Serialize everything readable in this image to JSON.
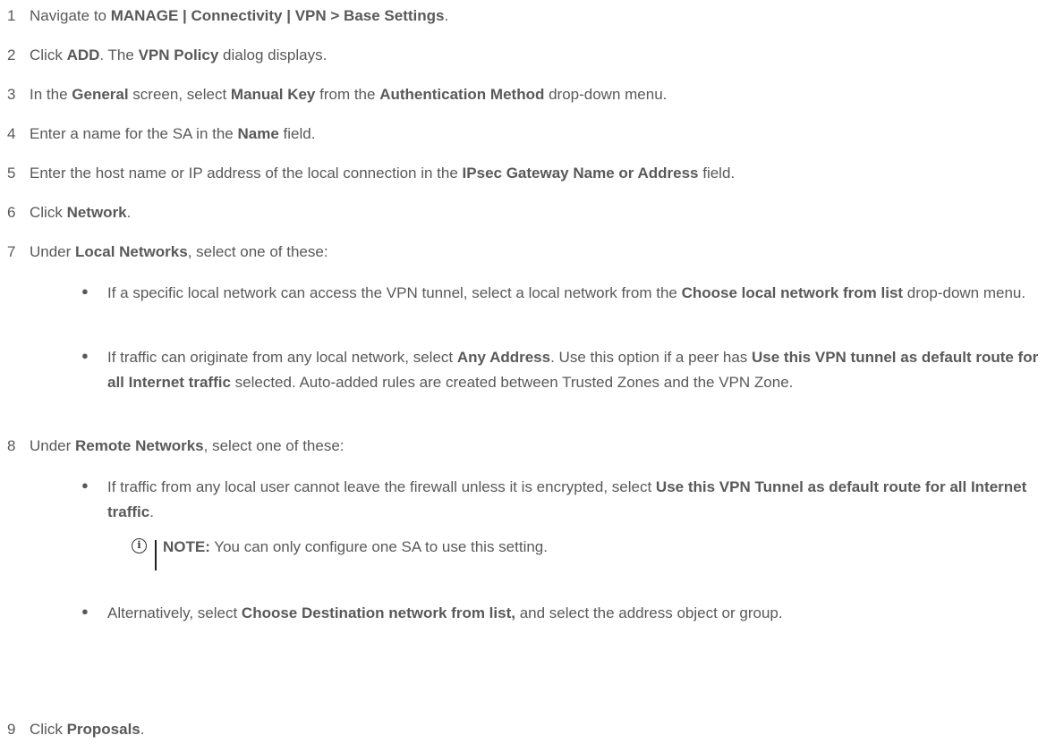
{
  "steps": [
    {
      "num": "1",
      "parts": [
        "Navigate to ",
        "MANAGE | Connectivity | VPN > Base Settings",
        "."
      ]
    },
    {
      "num": "2",
      "parts": [
        "Click ",
        "ADD",
        ". The ",
        "VPN Policy",
        " dialog displays."
      ]
    },
    {
      "num": "3",
      "parts": [
        "In the ",
        "General",
        " screen, select ",
        "Manual Key",
        " from the ",
        "Authentication Method",
        " drop-down menu."
      ]
    },
    {
      "num": "4",
      "parts": [
        "Enter a name for the SA in the ",
        "Name",
        " field."
      ]
    },
    {
      "num": "5",
      "parts": [
        "Enter the host name or IP address of the local connection in the ",
        "IPsec Gateway Name or Address",
        " field."
      ]
    },
    {
      "num": "6",
      "parts": [
        "Click ",
        "Network",
        "."
      ]
    },
    {
      "num": "7",
      "parts": [
        "Under ",
        "Local Networks",
        ", select one of these:"
      ]
    },
    {
      "num": "8",
      "parts": [
        "Under ",
        "Remote Networks",
        ", select one of these:"
      ]
    },
    {
      "num": "9",
      "parts": [
        "Click ",
        "Proposals",
        "."
      ]
    }
  ],
  "bullets_step7": [
    {
      "parts": [
        "If a specific local network can access the VPN tunnel, select a local network from the ",
        "Choose local network from list",
        " drop-down menu."
      ]
    },
    {
      "parts": [
        "If traffic can originate from any local network, select ",
        "Any Address",
        ". Use this option if a peer has ",
        "Use this VPN tunnel as default route for all Internet traffic",
        " selected. Auto-added rules are created between Trusted Zones and the VPN Zone."
      ]
    }
  ],
  "bullets_step8": [
    {
      "parts": [
        "If traffic from any local user cannot leave the firewall unless it is encrypted, select ",
        "Use this VPN Tunnel as default route for all Internet traffic",
        "."
      ]
    },
    {
      "parts": [
        "Alternatively, select ",
        "Choose Destination network from list,",
        " and select the address object or group."
      ]
    }
  ],
  "note": {
    "icon": "info-icon",
    "icon_glyph": "i",
    "label": "NOTE:",
    "text": " You can only configure one SA to use this setting."
  }
}
